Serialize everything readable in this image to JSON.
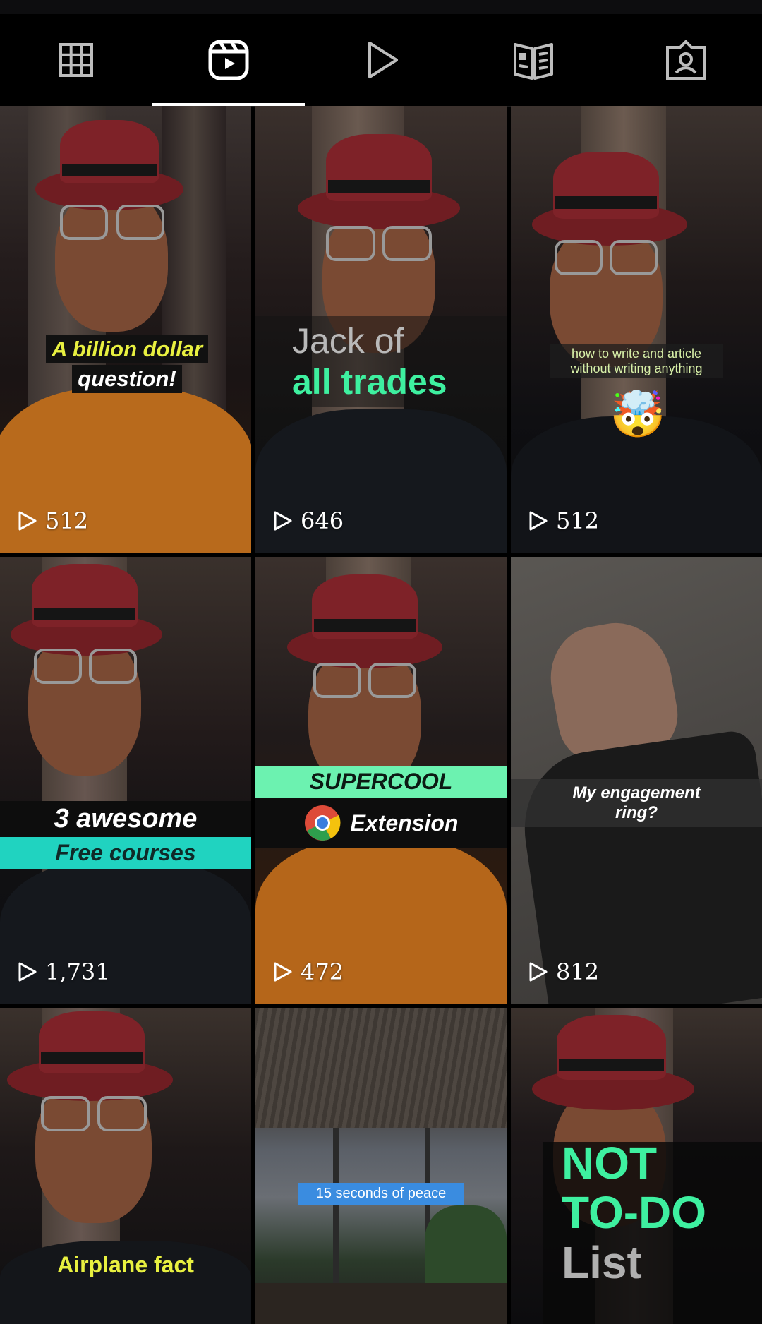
{
  "tabs": [
    {
      "name": "grid-icon"
    },
    {
      "name": "reels-icon",
      "active": true
    },
    {
      "name": "play-icon"
    },
    {
      "name": "guide-icon"
    },
    {
      "name": "tagged-icon"
    }
  ],
  "tiles": [
    {
      "caption_lines": [
        "A billion dollar",
        "question!"
      ],
      "views": "512"
    },
    {
      "caption_lines": [
        "Jack of",
        "all trades"
      ],
      "views": "646"
    },
    {
      "caption_lines": [
        "how to write and article",
        "without writing anything"
      ],
      "views": "512",
      "emoji": "🤯"
    },
    {
      "caption_lines": [
        "3 awesome",
        "Free courses"
      ],
      "views": "1,731"
    },
    {
      "caption_lines": [
        "SUPERCOOL",
        "Extension"
      ],
      "views": "472"
    },
    {
      "caption_lines": [
        "My engagement",
        "ring?"
      ],
      "views": "812"
    },
    {
      "caption_lines": [
        "Airplane fact"
      ]
    },
    {
      "caption_lines": [
        "15 seconds of peace"
      ]
    },
    {
      "caption_lines": [
        "NOT",
        "TO-DO",
        "List"
      ]
    }
  ],
  "colors": {
    "accent_green": "#3ef0a0",
    "caption_yellow": "#e8f040",
    "teal_bar": "#20d3c0"
  }
}
